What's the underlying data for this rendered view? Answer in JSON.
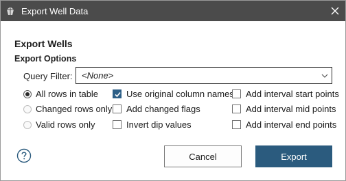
{
  "window": {
    "title": "Export Well Data"
  },
  "dialog": {
    "heading": "Export Wells",
    "section_title": "Export Options"
  },
  "query_filter": {
    "label": "Query Filter:",
    "value": "<None>"
  },
  "row_options": [
    {
      "label": "All rows in table",
      "selected": true
    },
    {
      "label": "Changed rows only",
      "selected": false
    },
    {
      "label": "Valid rows only",
      "selected": false
    }
  ],
  "column_options": [
    {
      "label": "Use original column names",
      "checked": true
    },
    {
      "label": "Add changed flags",
      "checked": false
    },
    {
      "label": "Invert dip values",
      "checked": false
    }
  ],
  "interval_options": [
    {
      "label": "Add interval start points",
      "checked": false
    },
    {
      "label": "Add interval mid points",
      "checked": false
    },
    {
      "label": "Add interval end points",
      "checked": false
    }
  ],
  "buttons": {
    "cancel": "Cancel",
    "export": "Export"
  },
  "colors": {
    "titlebar": "#4b4b4b",
    "primary_button": "#2b5b7e",
    "checkbox_checked": "#2d5f87"
  },
  "icons": {
    "app": "app-logo-icon",
    "close": "close-icon",
    "dropdown": "chevron-down-icon",
    "help": "help-icon"
  }
}
